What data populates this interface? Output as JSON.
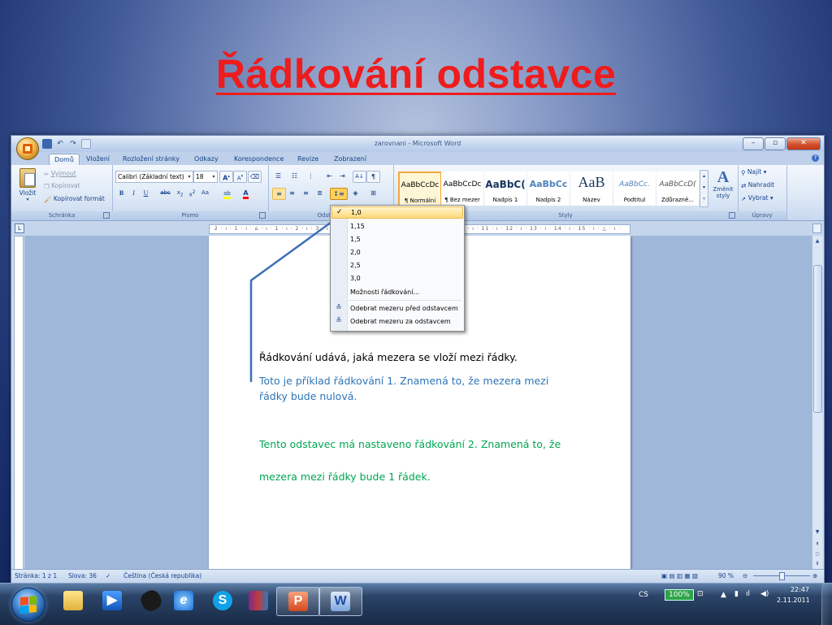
{
  "slide": {
    "title": "Řádkování odstavce"
  },
  "word": {
    "window_title": "zarovnani - Microsoft Word",
    "qat": {
      "undo": "↶",
      "redo": "↷"
    },
    "tabs": [
      "Domů",
      "Vložení",
      "Rozložení stránky",
      "Odkazy",
      "Korespondence",
      "Revize",
      "Zobrazení"
    ],
    "active_tab": "Domů",
    "clipboard": {
      "paste": "Vložit",
      "cut": "Vyjmout",
      "copy": "Kopírovat",
      "format_painter": "Kopírovat formát",
      "label": "Schránka"
    },
    "font": {
      "font_name": "Calibri (Základní text)",
      "font_size": "18",
      "label": "Písmo"
    },
    "paragraph": {
      "label": "Odstavec"
    },
    "styles": {
      "label": "Styly",
      "items": [
        {
          "sample": "AaBbCcDc",
          "name": "¶ Normální"
        },
        {
          "sample": "AaBbCcDc",
          "name": "¶ Bez mezer"
        },
        {
          "sample": "AaBbC(",
          "name": "Nadpis 1"
        },
        {
          "sample": "AaBbCc",
          "name": "Nadpis 2"
        },
        {
          "sample": "AaB",
          "name": "Název"
        },
        {
          "sample": "AaBbCc.",
          "name": "Podtitul"
        },
        {
          "sample": "AaBbCcD(",
          "name": "Zdůrazně..."
        }
      ],
      "change_styles": "Změnit styly"
    },
    "editing": {
      "find": "Najít",
      "replace": "Nahradit",
      "select": "Vybrat",
      "label": "Úpravy"
    },
    "line_spacing_menu": {
      "items": [
        "1,0",
        "1,15",
        "1,5",
        "2,0",
        "2,5",
        "3,0"
      ],
      "selected": "1,0",
      "options": "Možnosti řádkování...",
      "remove_before": "Odebrat mezeru před odstavcem",
      "remove_after": "Odebrat mezeru za odstavcem"
    },
    "document": {
      "p1": "Řádkování udává, jaká mezera se vloží mezi řádky.",
      "p2_line1": "Toto je příklad řádkování 1. Znamená to, že mezera mezi",
      "p2_line2": "řádky bude nulová.",
      "p3_line1": "Tento odstavec má nastaveno řádkování 2. Znamená to, že",
      "p3_line2": "mezera mezi řádky bude 1 řádek."
    },
    "status": {
      "page": "Stránka: 1 z 1",
      "words": "Slova: 36",
      "language": "Čeština (Česká republika)",
      "zoom": "90 %"
    }
  },
  "taskbar": {
    "lang": "CS",
    "battery": "100%",
    "time": "22:47",
    "date": "2.11.2011"
  },
  "colors": {
    "title_red": "#ee1c1c",
    "doc_black": "#000000",
    "doc_blue": "#2e75b6",
    "doc_green": "#00a651",
    "arrow_blue": "#3e6fb5"
  }
}
